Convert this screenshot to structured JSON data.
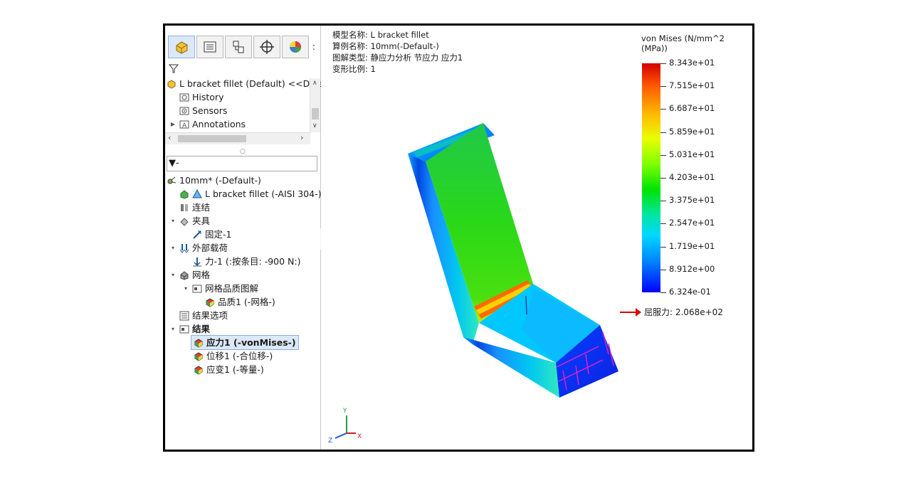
{
  "feature_manager": {
    "tabs": [
      "feature-tree-icon",
      "property-manager-icon",
      "configuration-manager-icon",
      "dimxpert-icon",
      "display-manager-icon"
    ],
    "more": ":",
    "model_tree": [
      {
        "label": "L bracket  fillet (Default) <<Defa",
        "icon": "part-icon",
        "level": 0
      },
      {
        "label": "History",
        "icon": "history-icon",
        "level": 1
      },
      {
        "label": "Sensors",
        "icon": "sensors-icon",
        "level": 1
      },
      {
        "label": "Annotations",
        "icon": "annotations-icon",
        "level": 1,
        "expandable": true
      }
    ],
    "filter_text": "▼-"
  },
  "study_tree": {
    "study": "10mm* (-Default-)",
    "part": "L bracket  fillet (-AISI 304-)",
    "connections": "连结",
    "fixtures": "夹具",
    "fixture_1": "固定-1",
    "external_loads": "外部载荷",
    "force_1": "力-1 (:按条目: -900 N:)",
    "mesh": "网格",
    "mesh_quality_plot": "网格品质图解",
    "quality_1": "品质1 (-网格-)",
    "result_options": "结果选项",
    "results": "结果",
    "stress_1": "应力1 (-vonMises-)",
    "displacement_1": "位移1 (-合位移-)",
    "strain_1": "应变1 (-等量-)"
  },
  "viewport": {
    "info_lines": [
      "模型名称: L bracket  fillet",
      "算例名称: 10mm(-Default-)",
      "图解类型: 静应力分析 节应力 应力1",
      "变形比例: 1"
    ],
    "legend_title": "von Mises (N/mm^2 (MPa))",
    "legend_labels": [
      "8.343e+01",
      "7.515e+01",
      "6.687e+01",
      "5.859e+01",
      "5.031e+01",
      "4.203e+01",
      "3.375e+01",
      "2.547e+01",
      "1.719e+01",
      "8.912e+00",
      "6.324e-01"
    ],
    "yield": "屈服力: 2.068e+02",
    "triad": {
      "x": "X",
      "y": "Y",
      "z": "Z"
    },
    "colors": {
      "max": "#d40000",
      "min": "#0000ff",
      "load_arrows": "#e020d0"
    }
  }
}
